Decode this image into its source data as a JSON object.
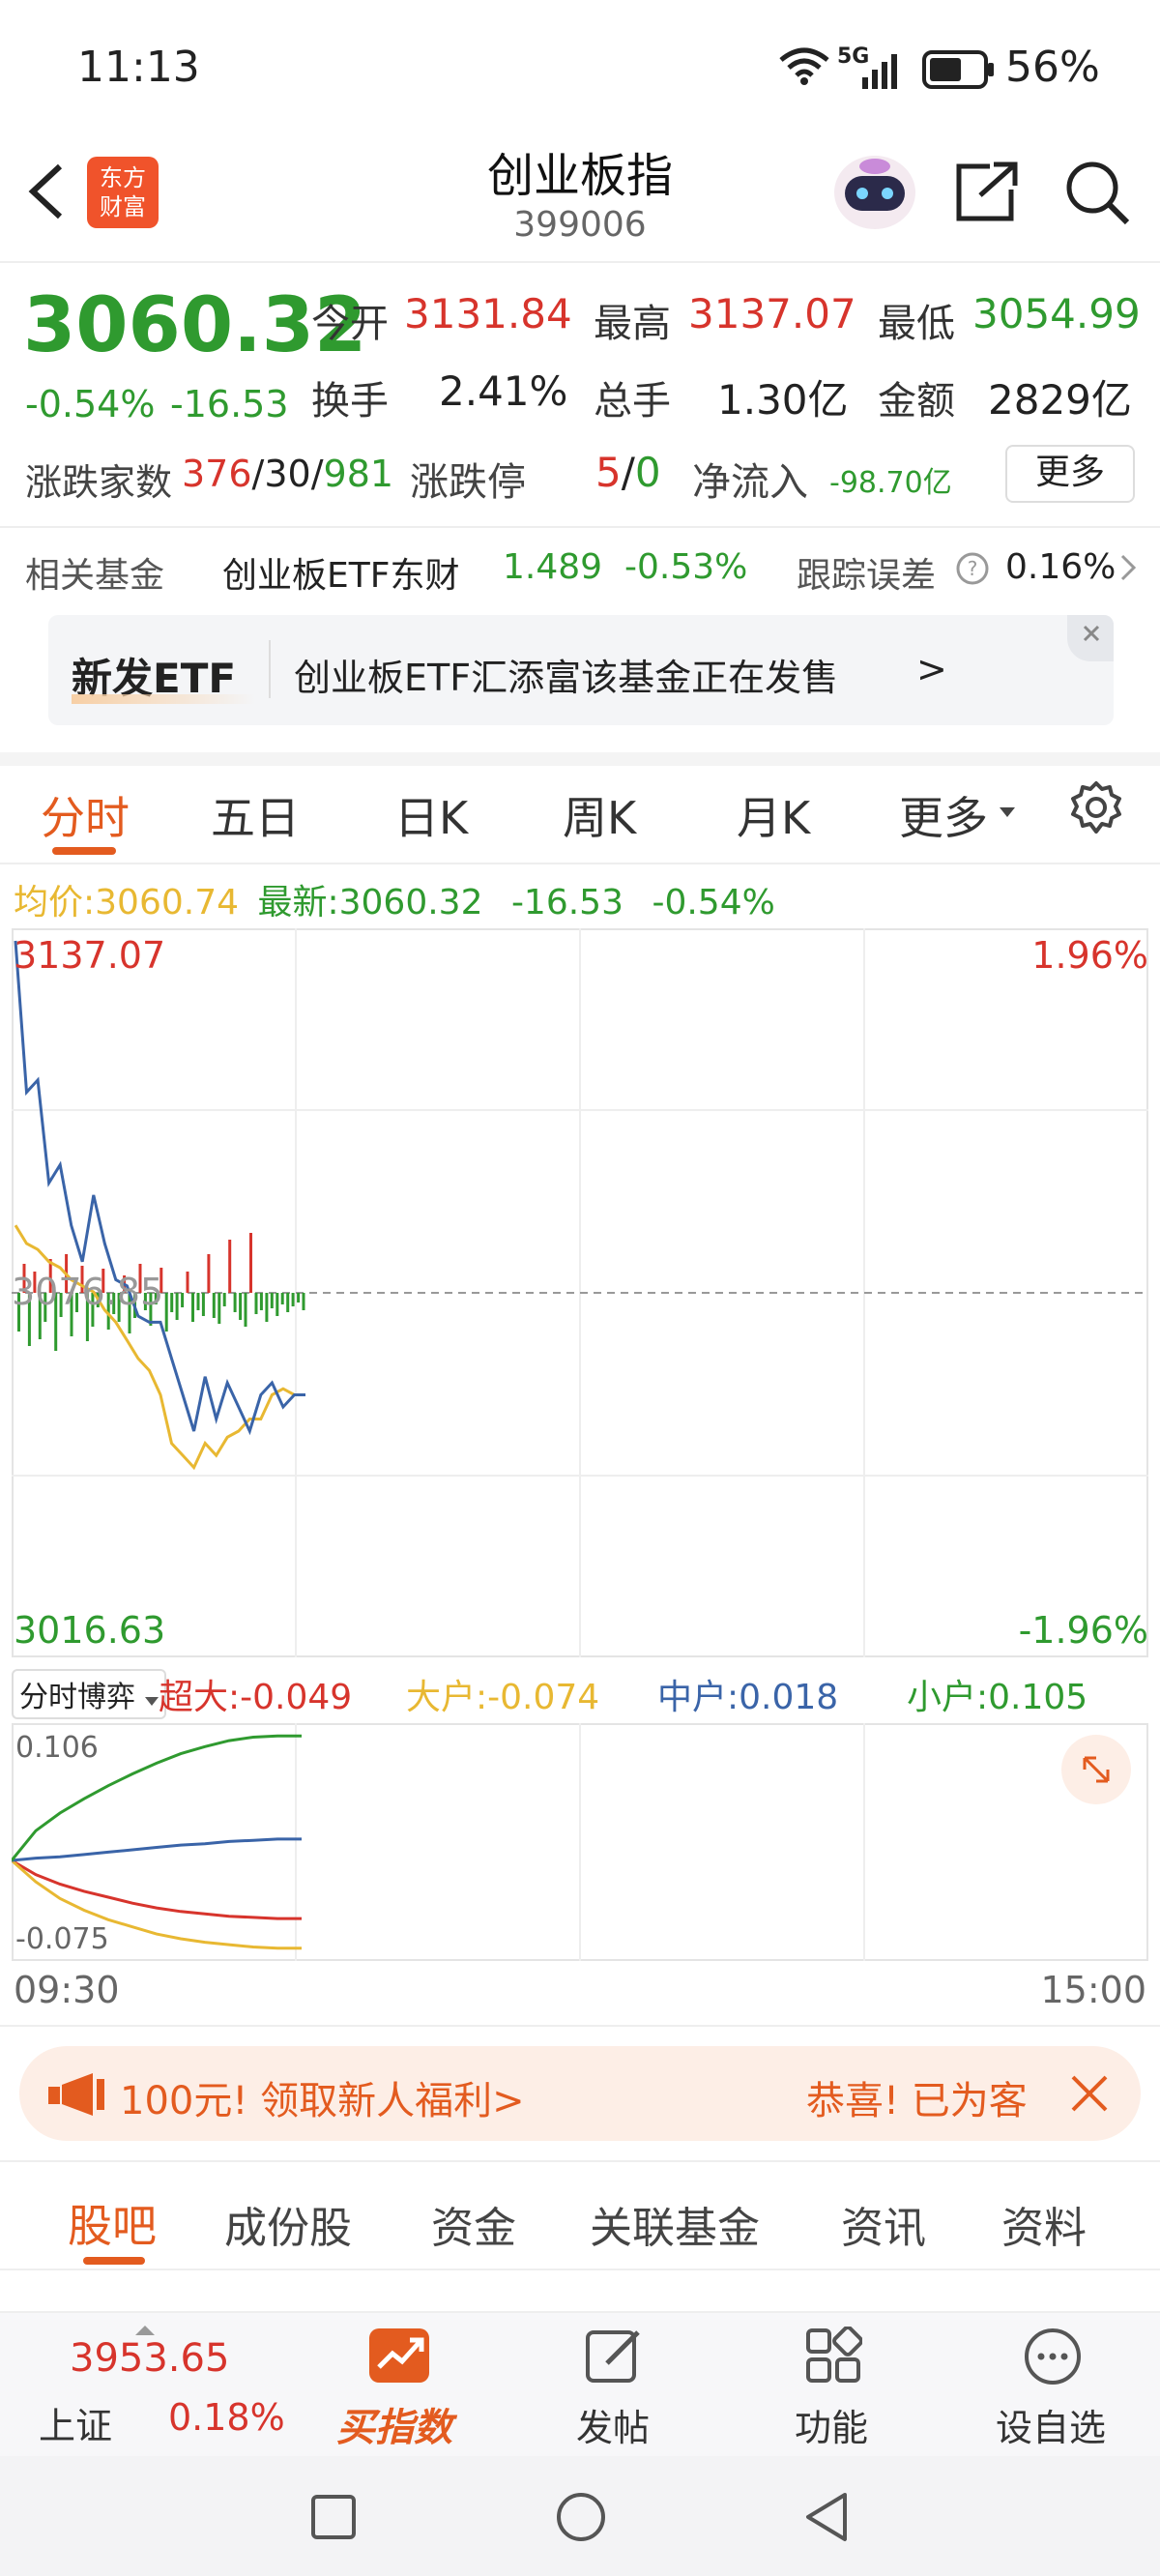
{
  "status_bar": {
    "time": "11:13",
    "network": "5G",
    "battery": "56%"
  },
  "header": {
    "title": "创业板指",
    "code": "399006",
    "logo_line1": "东方",
    "logo_line2": "财富"
  },
  "quote": {
    "price": "3060.32",
    "change_pct": "-0.54%",
    "change": "-16.53",
    "open_label": "今开",
    "open": "3131.84",
    "high_label": "最高",
    "high": "3137.07",
    "low_label": "最低",
    "low": "3054.99",
    "turnover_label": "换手",
    "turnover": "2.41%",
    "volume_label": "总手",
    "volume": "1.30亿",
    "amount_label": "金额",
    "amount": "2829亿",
    "updown_label": "涨跌家数",
    "up": "376",
    "flat": "30",
    "down": "981",
    "limit_label": "涨跌停",
    "limit_up": "5",
    "limit_down": "0",
    "netflow_label": "净流入",
    "netflow": "-98.70亿",
    "more": "更多"
  },
  "fund": {
    "label": "相关基金",
    "name": "创业板ETF东财",
    "price": "1.489",
    "pct": "-0.53%",
    "tracking_label": "跟踪误差",
    "tracking": "0.16%"
  },
  "banner": {
    "tag": "新发ETF",
    "text": "创业板ETF汇添富该基金正在发售",
    "arrow": ">"
  },
  "tabs": [
    "分时",
    "五日",
    "日K",
    "周K",
    "月K",
    "更多"
  ],
  "avg_line": {
    "avg_label": "均价:",
    "avg": "3060.74",
    "latest_label": "最新:",
    "latest": "3060.32",
    "chg": "-16.53",
    "pct": "-0.54%"
  },
  "chart": {
    "top_price": "3137.07",
    "top_pct": "1.96%",
    "bottom_price": "3016.63",
    "bottom_pct": "-1.96%",
    "mid_price": "3076.85"
  },
  "flow": {
    "select": "分时博弈",
    "super": "超大:-0.049",
    "big": "大户:-0.074",
    "mid": "中户:0.018",
    "small": "小户:0.105",
    "max": "0.106",
    "min": "-0.075",
    "start_time": "09:30",
    "end_time": "15:00"
  },
  "promo": {
    "text": "100元! 领取新人福利>",
    "right": "恭喜! 已为客"
  },
  "sub_tabs": [
    "股吧",
    "成份股",
    "资金",
    "关联基金",
    "资讯",
    "资料"
  ],
  "bottom": {
    "index_price": "3953.65",
    "index_name": "上证",
    "index_pct": "0.18%",
    "buy": "买指数",
    "post": "发帖",
    "func": "功能",
    "watch": "设自选"
  },
  "colors": {
    "up": "#d7342c",
    "down": "#2f9a2f",
    "price_line": "#3a64a8",
    "avg_line": "#e8b832",
    "accent": "#e35b1f"
  },
  "chart_data": [
    {
      "type": "line",
      "title": "",
      "series": [
        {
          "name": "最新",
          "values": [
            3135,
            3110,
            3112,
            3095,
            3098,
            3088,
            3082,
            3093,
            3085,
            3079,
            3078,
            3073,
            3072,
            3072,
            3066,
            3060,
            3054,
            3063,
            3056,
            3062,
            3058,
            3054,
            3060,
            3062,
            3058,
            3060,
            3060
          ]
        },
        {
          "name": "均价",
          "values": [
            3088,
            3085,
            3084,
            3082,
            3081,
            3079,
            3078,
            3077,
            3074,
            3072,
            3069,
            3066,
            3064,
            3060,
            3052,
            3050,
            3048,
            3052,
            3050,
            3053,
            3054,
            3056,
            3056,
            3060,
            3061,
            3060,
            3060
          ]
        }
      ],
      "ylim": [
        3016.63,
        3137.07
      ],
      "grid": true
    },
    {
      "type": "line",
      "title": "",
      "series": [
        {
          "name": "超大",
          "values": [
            0,
            -0.012,
            -0.02,
            -0.026,
            -0.031,
            -0.036,
            -0.04,
            -0.043,
            -0.045,
            -0.047,
            -0.048,
            -0.049,
            -0.049
          ]
        },
        {
          "name": "大户",
          "values": [
            0,
            -0.018,
            -0.032,
            -0.042,
            -0.05,
            -0.056,
            -0.062,
            -0.066,
            -0.069,
            -0.071,
            -0.073,
            -0.074,
            -0.074
          ]
        },
        {
          "name": "中户",
          "values": [
            0,
            0.002,
            0.003,
            0.005,
            0.007,
            0.009,
            0.011,
            0.013,
            0.014,
            0.016,
            0.017,
            0.018,
            0.018
          ]
        },
        {
          "name": "小户",
          "values": [
            0,
            0.025,
            0.04,
            0.052,
            0.063,
            0.073,
            0.082,
            0.09,
            0.096,
            0.101,
            0.104,
            0.105,
            0.105
          ]
        }
      ],
      "ylim": [
        -0.075,
        0.106
      ],
      "grid": true
    }
  ]
}
